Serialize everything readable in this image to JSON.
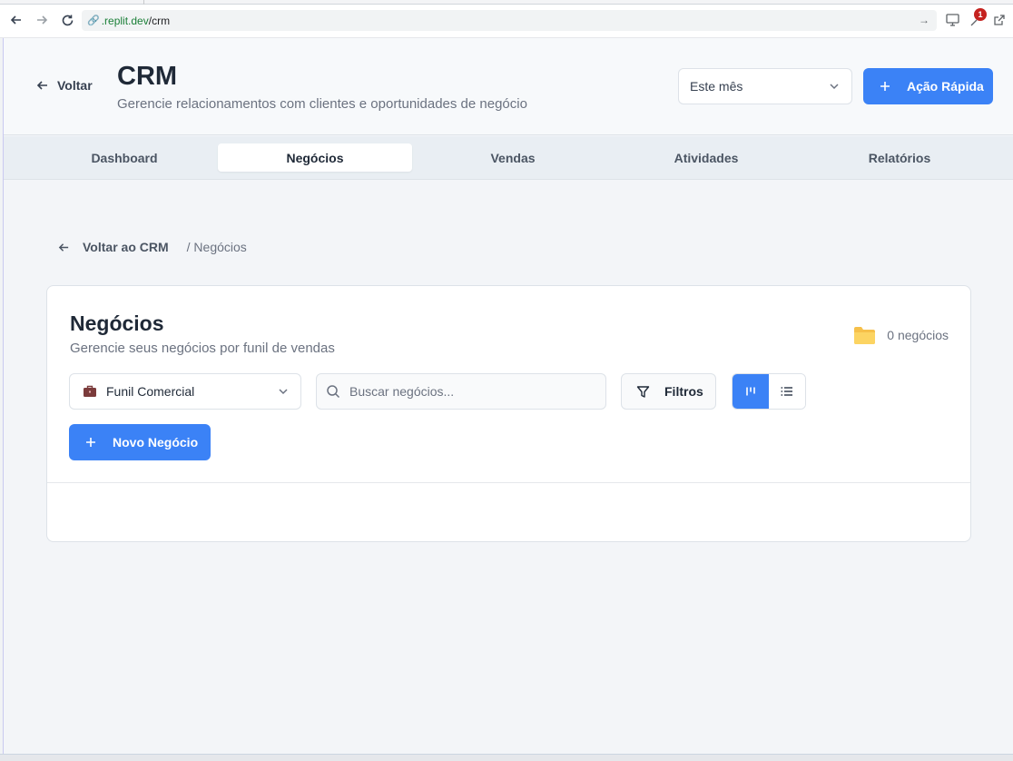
{
  "browser": {
    "url_domain": ".replit.dev",
    "url_path": "/crm",
    "extension_badge": "1"
  },
  "header": {
    "back_label": "Voltar",
    "title": "CRM",
    "subtitle": "Gerencie relacionamentos com clientes e oportunidades de negócio",
    "period_value": "Este mês",
    "quick_action_label": "Ação Rápida"
  },
  "tabs": [
    {
      "label": "Dashboard",
      "active": false
    },
    {
      "label": "Negócios",
      "active": true
    },
    {
      "label": "Vendas",
      "active": false
    },
    {
      "label": "Atividades",
      "active": false
    },
    {
      "label": "Relatórios",
      "active": false
    }
  ],
  "breadcrumb": {
    "back_label": "Voltar ao CRM",
    "current": "/ Negócios"
  },
  "deals": {
    "title": "Negócios",
    "subtitle": "Gerencie seus negócios por funil de vendas",
    "count_label": "0 negócios",
    "funnel_value": "Funil Comercial",
    "search_placeholder": "Buscar negócios...",
    "filters_label": "Filtros",
    "new_deal_label": "Novo Negócio",
    "view_mode": "kanban"
  },
  "colors": {
    "accent": "#3b82f6",
    "folder": "#f6c04a",
    "briefcase": "#7b3b3b"
  }
}
